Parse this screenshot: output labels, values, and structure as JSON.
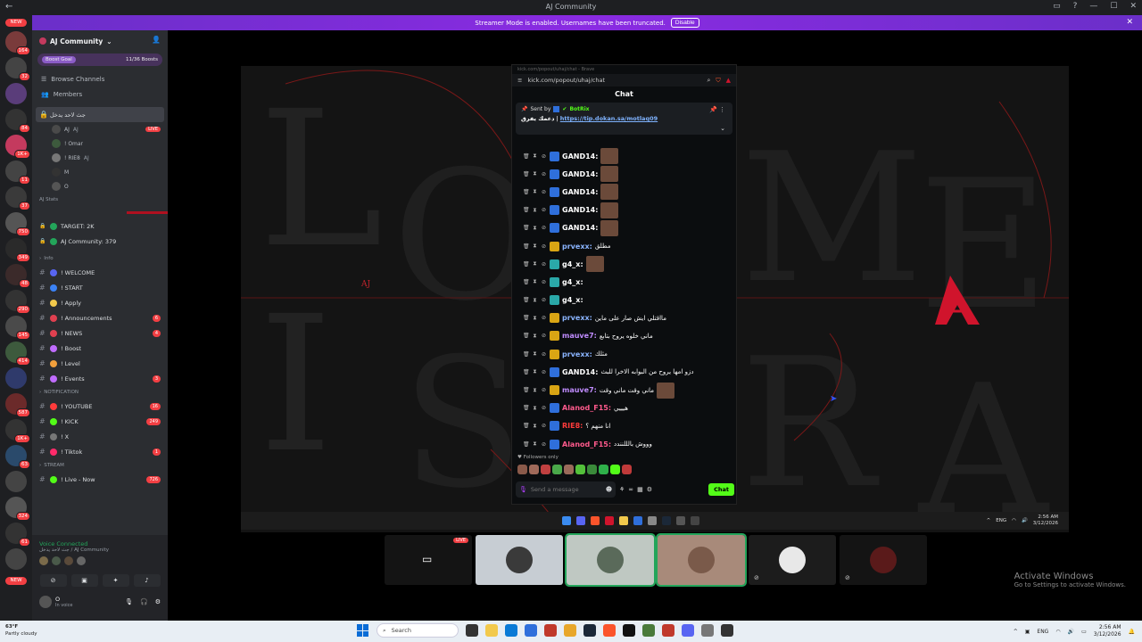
{
  "window": {
    "title": "AJ Community",
    "banner_text": "Streamer Mode is enabled. Usernames have been truncated.",
    "banner_button": "Disable"
  },
  "rail": {
    "new_label": "NEW",
    "servers": [
      {
        "badge": "164",
        "color": "#7a3b3b"
      },
      {
        "badge": "32",
        "color": "#444"
      },
      {
        "badge": "",
        "color": "#5a3d7a"
      },
      {
        "badge": "84",
        "color": "#333"
      },
      {
        "badge": "1K+",
        "color": "#c43a5e"
      },
      {
        "badge": "11",
        "color": "#444"
      },
      {
        "badge": "37",
        "color": "#3a3a3a"
      },
      {
        "badge": "750",
        "color": "#555"
      },
      {
        "badge": "349",
        "color": "#2a2a2a"
      },
      {
        "badge": "48",
        "color": "#3b2a2a"
      },
      {
        "badge": "290",
        "color": "#333"
      },
      {
        "badge": "145",
        "color": "#4a4a4a"
      },
      {
        "badge": "414",
        "color": "#3d5a3d"
      },
      {
        "badge": "",
        "color": "#2f3a6b"
      },
      {
        "badge": "587",
        "color": "#6b2a2a"
      },
      {
        "badge": "1K+",
        "color": "#333"
      },
      {
        "badge": "63",
        "color": "#2a4a6b"
      },
      {
        "badge": "",
        "color": "#444"
      },
      {
        "badge": "324",
        "color": "#555"
      },
      {
        "badge": "61",
        "color": "#333"
      },
      {
        "badge": "",
        "color": "#444"
      }
    ],
    "bottom_new": "NEW"
  },
  "sidebar": {
    "server_name": "AJ Community",
    "boost_goal": "Boost Goal",
    "boosts": "11/36 Boosts",
    "browse": "Browse Channels",
    "members": "Members",
    "voice_channel": "جث لاحد يدخل",
    "voice_users": [
      {
        "name": "AJ",
        "extra": "AJ",
        "live": "LIVE",
        "color": "#4a4a4a"
      },
      {
        "name": "! Omar",
        "extra": "",
        "live": "",
        "color": "#3d5a3d"
      },
      {
        "name": "! RIE8",
        "extra": "AJ",
        "live": "",
        "color": "#777"
      },
      {
        "name": "M",
        "extra": "",
        "live": "",
        "color": "#333"
      },
      {
        "name": "O",
        "extra": "",
        "live": "",
        "color": "#555"
      }
    ],
    "stats_cat": "AJ Stats",
    "stats": [
      {
        "label": "TARGET: 2K"
      },
      {
        "label": "AJ Community: 379"
      }
    ],
    "info_cat": "Info",
    "info_channels": [
      {
        "name": "! WELCOME",
        "count": "",
        "color": "#5865f2"
      },
      {
        "name": "! START",
        "count": "",
        "color": "#3b82f6"
      },
      {
        "name": "! Apply",
        "count": "",
        "color": "#f2c94c"
      },
      {
        "name": "! Announcements",
        "count": "6",
        "color": "#e04050"
      },
      {
        "name": "! NEWS",
        "count": "4",
        "color": "#e04050"
      },
      {
        "name": "! Boost",
        "count": "",
        "color": "#c06cff"
      },
      {
        "name": "! Level",
        "count": "",
        "color": "#f2a03c"
      },
      {
        "name": "! Events",
        "count": "3",
        "color": "#c06cff"
      }
    ],
    "notif_cat": "NOTIFICATION",
    "notif_channels": [
      {
        "name": "! YOUTUBE",
        "count": "16",
        "color": "#ff3b3b"
      },
      {
        "name": "! KICK",
        "count": "249",
        "color": "#53fc18"
      },
      {
        "name": "! X",
        "count": "",
        "color": "#777"
      },
      {
        "name": "! Tiktok",
        "count": "1",
        "color": "#ff2a6a"
      }
    ],
    "stream_cat": "STREAM",
    "stream_channels": [
      {
        "name": "! Live - Now",
        "count": "726",
        "color": "#53fc18"
      }
    ],
    "voice_connected": "Voice Connected",
    "voice_sub": "جث لاحد يدخل / AJ Community",
    "user_name": "O",
    "user_status": "In voice"
  },
  "chat": {
    "window_title": "kick.com/popout/uhaj/chat - Brave",
    "url": "kick.com/popout/uhaj/chat",
    "header": "Chat",
    "pinned_by": "Sent by",
    "pinned_bot": "BotRix",
    "pinned_text": "دعمك يفرق",
    "pinned_link": "https://tip.dokan.sa/motlaq09",
    "messages": [
      {
        "user": "GAND14:",
        "color": "#ffffff",
        "badge": "#2f6fdb",
        "text": "",
        "thumb": true
      },
      {
        "user": "GAND14:",
        "color": "#ffffff",
        "badge": "#2f6fdb",
        "text": "",
        "thumb": true
      },
      {
        "user": "GAND14:",
        "color": "#ffffff",
        "badge": "#2f6fdb",
        "text": "",
        "thumb": true
      },
      {
        "user": "GAND14:",
        "color": "#ffffff",
        "badge": "#2f6fdb",
        "text": "",
        "thumb": true
      },
      {
        "user": "GAND14:",
        "color": "#ffffff",
        "badge": "#2f6fdb",
        "text": "",
        "thumb": true
      },
      {
        "user": "prvexx:",
        "color": "#8ab4ff",
        "badge": "#d9a514",
        "text": "مطلق",
        "thumb": false
      },
      {
        "user": "g4_x:",
        "color": "#ffffff",
        "badge": "#2aa8a8",
        "text": "",
        "thumb": true
      },
      {
        "user": "g4_x:",
        "color": "#ffffff",
        "badge": "#2aa8a8",
        "text": "",
        "thumb": false
      },
      {
        "user": "g4_x:",
        "color": "#ffffff",
        "badge": "#2aa8a8",
        "text": "",
        "thumb": false
      },
      {
        "user": "prvexx:",
        "color": "#8ab4ff",
        "badge": "#d9a514",
        "text": "مااقتلي ايش صار على ماين",
        "thumb": false
      },
      {
        "user": "mauve7:",
        "color": "#c08cff",
        "badge": "#d9a514",
        "text": "ماني خلوه يروح بتابع",
        "thumb": false
      },
      {
        "user": "prvexx:",
        "color": "#8ab4ff",
        "badge": "#d9a514",
        "text": "مثلك",
        "thumb": false
      },
      {
        "user": "GAND14:",
        "color": "#ffffff",
        "badge": "#2f6fdb",
        "text": "دزو امها يروح من البوابه الاخرا للبث",
        "thumb": false
      },
      {
        "user": "mauve7:",
        "color": "#c08cff",
        "badge": "#d9a514",
        "text": "ماني وقت ماني وقت",
        "thumb": true
      },
      {
        "user": "Alanod_F15:",
        "color": "#ff5a8c",
        "badge": "#2f6fdb",
        "text": "هيييي",
        "thumb": false
      },
      {
        "user": "RIE8:",
        "color": "#ff3b3b",
        "badge": "#2f6fdb",
        "text": "انا منهم ؟",
        "thumb": false
      },
      {
        "user": "Alanod_F15:",
        "color": "#ff5a8c",
        "badge": "#2f6fdb",
        "text": "وووش بالللنندد",
        "thumb": false
      }
    ],
    "followers_only": "Followers only",
    "input_placeholder": "Send a message",
    "send_label": "Chat"
  },
  "stream_taskbar": {
    "lang": "ENG",
    "time": "2:56 AM",
    "date": "3/12/2026"
  },
  "tiles": {
    "live_label": "LIVE"
  },
  "activate": {
    "title": "Activate Windows",
    "subtitle": "Go to Settings to activate Windows."
  },
  "taskbar": {
    "temp": "63°F",
    "weather": "Partly cloudy",
    "search_placeholder": "Search",
    "lang": "ENG",
    "time": "2:56 AM",
    "date": "3/12/2026"
  },
  "stream_art": {
    "small_text": "AJ"
  },
  "colors": {
    "accent": "#5865f2",
    "kick_green": "#53fc18",
    "red": "#f23f43"
  }
}
